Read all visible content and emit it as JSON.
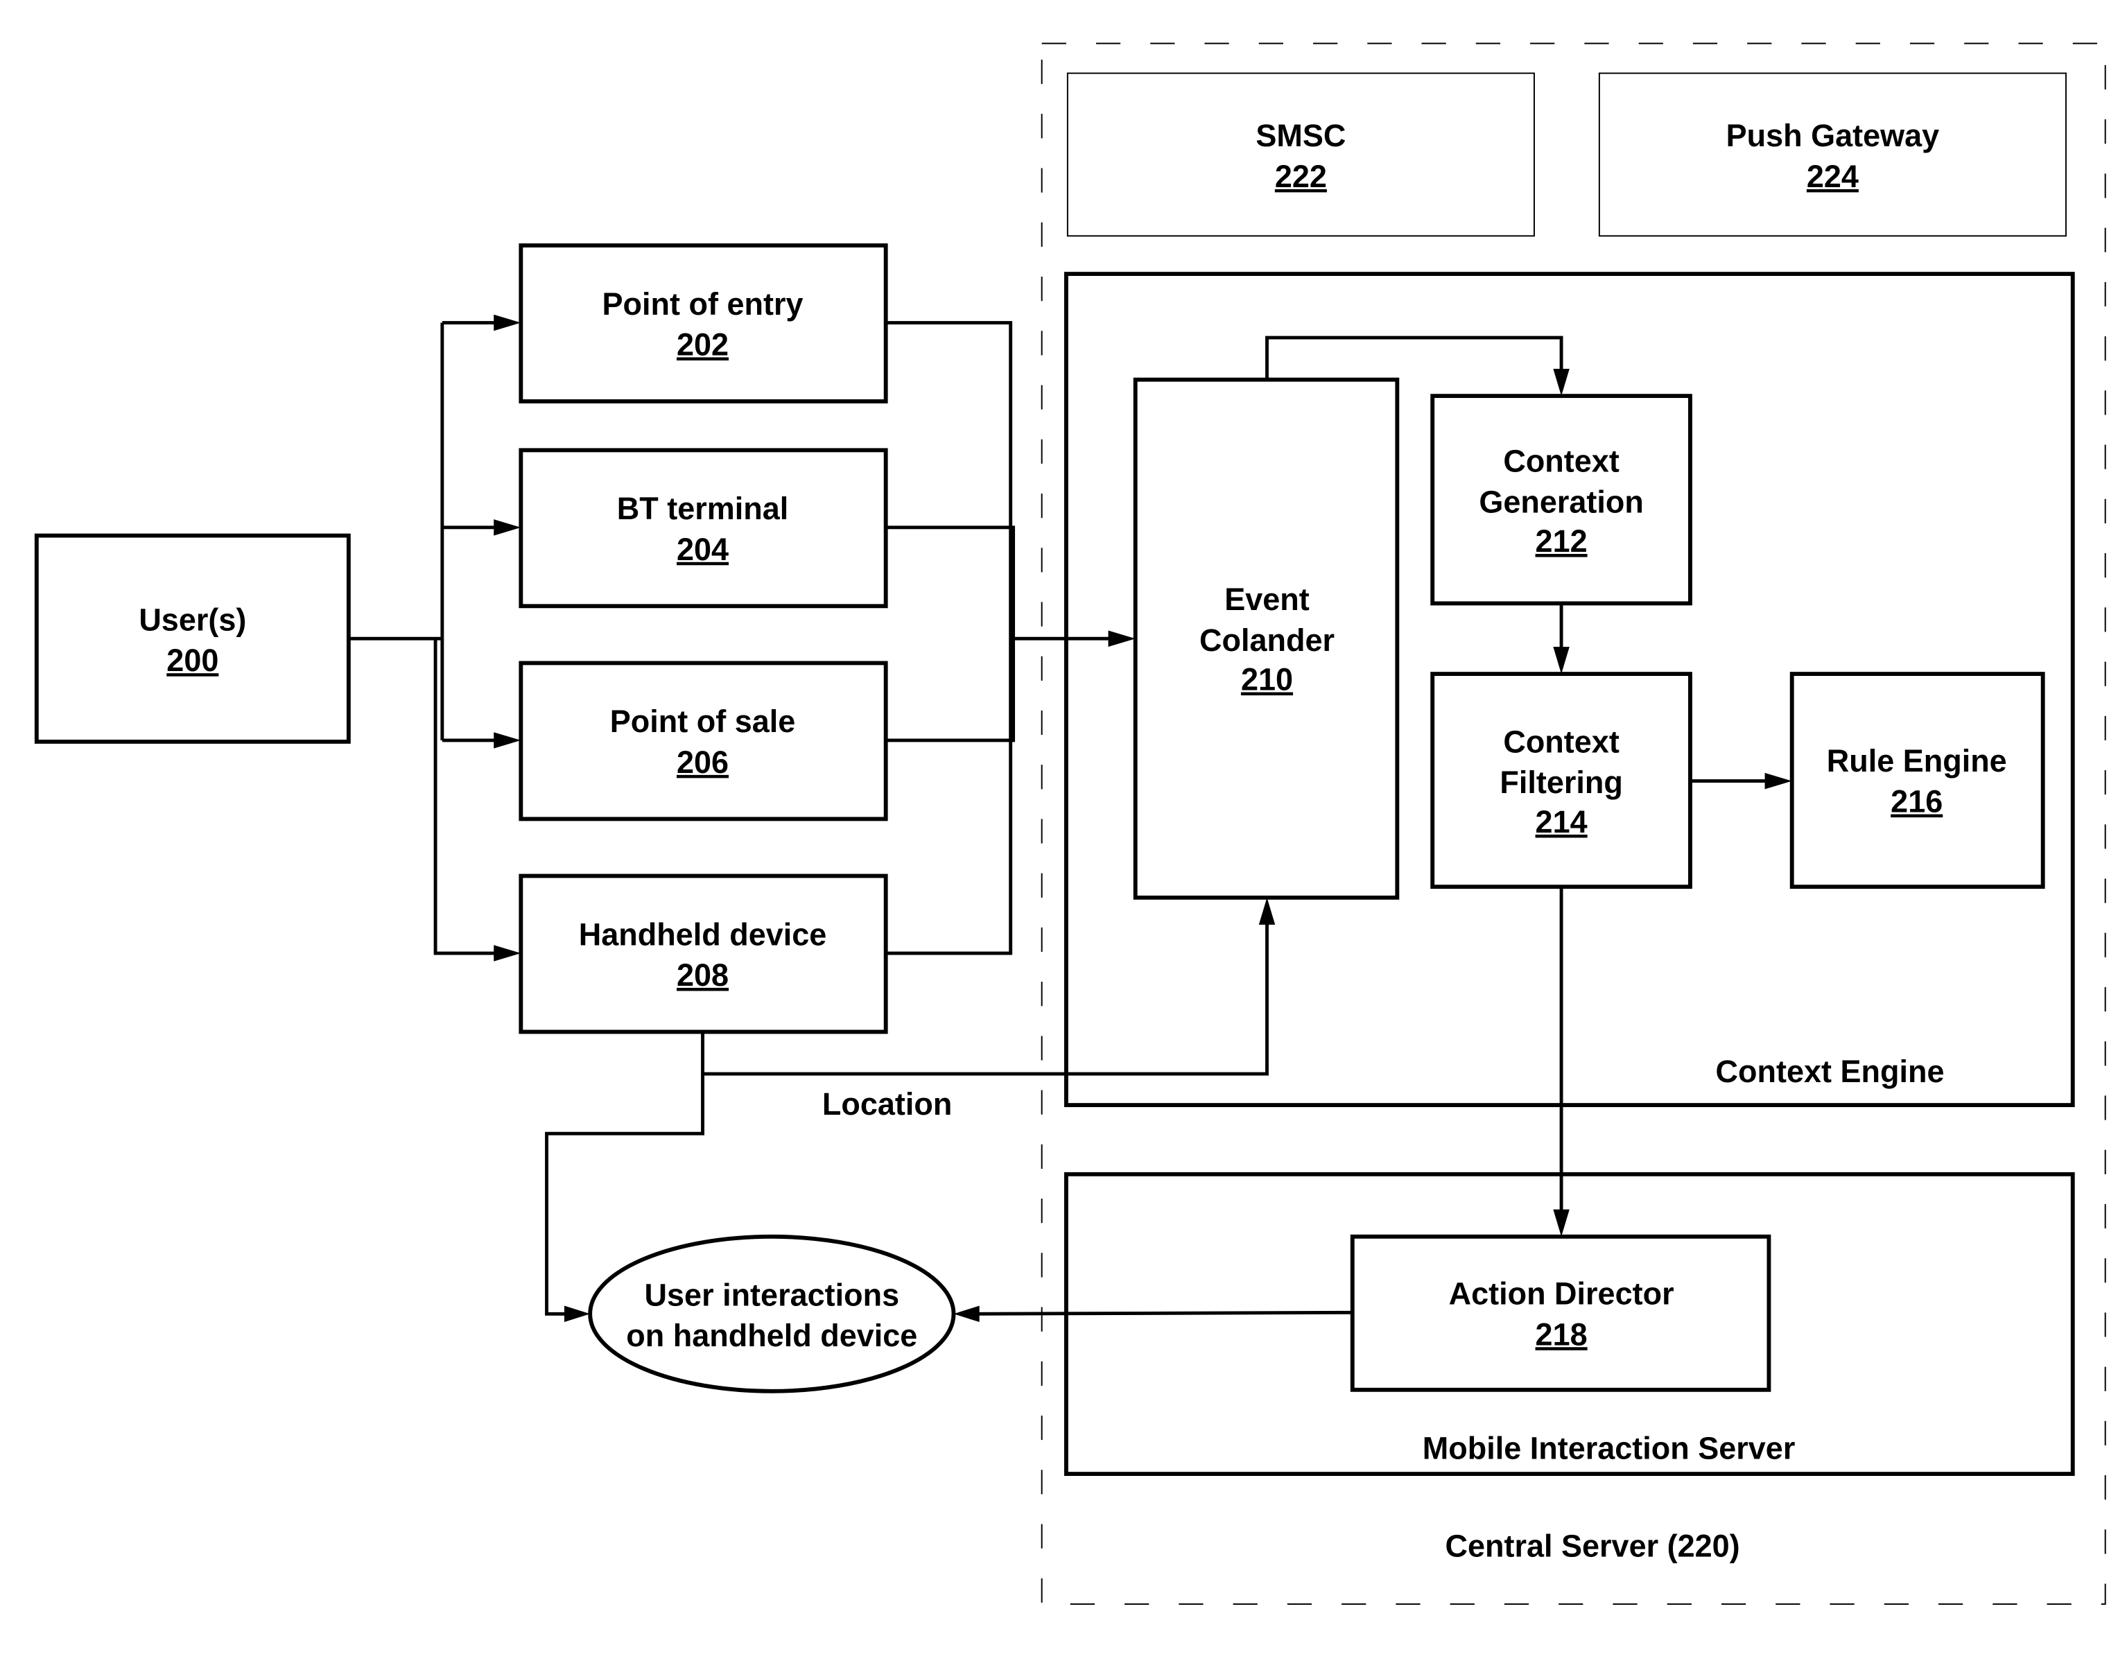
{
  "diagram": {
    "container": {
      "label": "Central Server (220)"
    },
    "nodes": {
      "users": {
        "title": "User(s)",
        "ref": "200"
      },
      "point_of_entry": {
        "title": "Point of entry",
        "ref": "202"
      },
      "bt_terminal": {
        "title": "BT terminal",
        "ref": "204"
      },
      "point_of_sale": {
        "title": "Point of sale",
        "ref": "206"
      },
      "handheld_device": {
        "title": "Handheld device",
        "ref": "208"
      },
      "event_colander": {
        "title_line1": "Event",
        "title_line2": "Colander",
        "ref": "210"
      },
      "context_generation": {
        "title_line1": "Context",
        "title_line2": "Generation",
        "ref": "212"
      },
      "context_filtering": {
        "title_line1": "Context",
        "title_line2": "Filtering",
        "ref": "214"
      },
      "rule_engine": {
        "title": "Rule Engine",
        "ref": "216"
      },
      "action_director": {
        "title": "Action Director",
        "ref": "218"
      },
      "smsc": {
        "title": "SMSC",
        "ref": "222"
      },
      "push_gateway": {
        "title": "Push Gateway",
        "ref": "224"
      },
      "user_interactions": {
        "line1": "User interactions",
        "line2": "on handheld device"
      }
    },
    "groups": {
      "context_engine": {
        "label": "Context Engine"
      },
      "mobile_interaction_server": {
        "label": "Mobile Interaction Server"
      }
    },
    "edge_labels": {
      "location": "Location"
    },
    "edges": [
      {
        "from": "User(s) 200",
        "to": "Point of entry 202"
      },
      {
        "from": "User(s) 200",
        "to": "BT terminal 204"
      },
      {
        "from": "User(s) 200",
        "to": "Point of sale 206"
      },
      {
        "from": "User(s) 200",
        "to": "Handheld device 208"
      },
      {
        "from": "Point of entry 202 / BT terminal 204 / Point of sale 206 / Handheld device 208",
        "to": "Event Colander 210"
      },
      {
        "from": "Handheld device 208",
        "to": "Event Colander 210",
        "label": "Location"
      },
      {
        "from": "Handheld device 208",
        "to": "User interactions on handheld device"
      },
      {
        "from": "Event Colander 210",
        "to": "Context Generation 212"
      },
      {
        "from": "Context Generation 212",
        "to": "Context Filtering 214"
      },
      {
        "from": "Context Filtering 214",
        "to": "Rule Engine 216"
      },
      {
        "from": "Context Filtering 214",
        "to": "Action Director 218"
      },
      {
        "from": "Action Director 218",
        "to": "User interactions on handheld device"
      }
    ]
  }
}
